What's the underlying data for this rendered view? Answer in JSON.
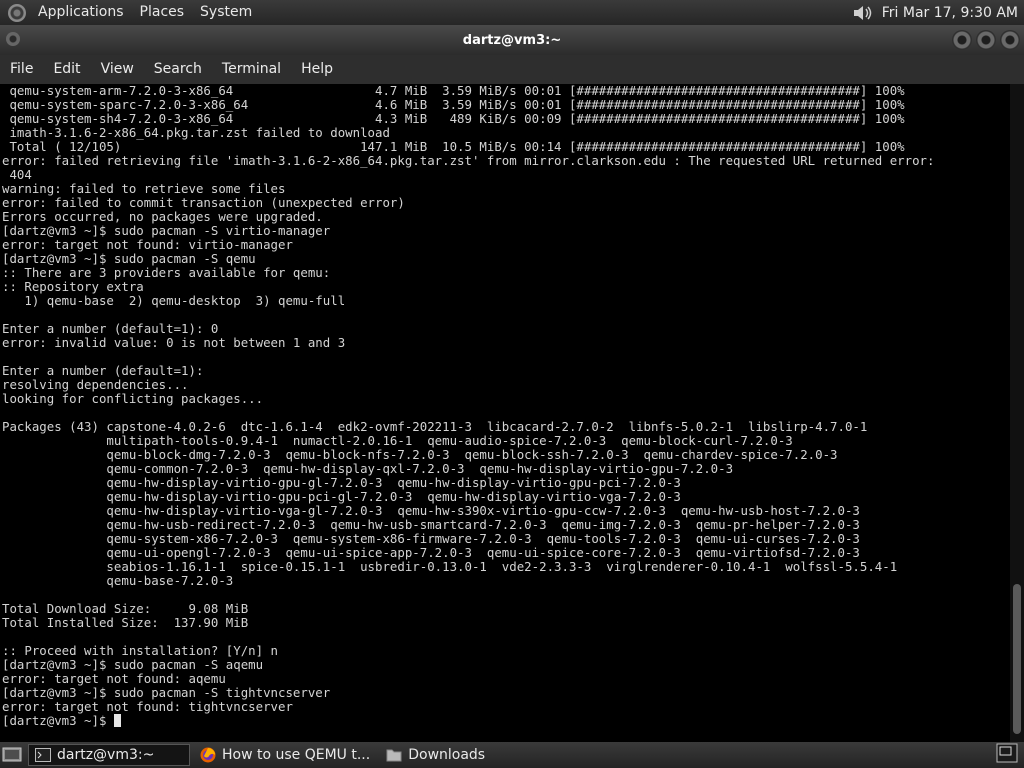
{
  "topbar": {
    "menus": [
      "Applications",
      "Places",
      "System"
    ],
    "datetime": "Fri Mar 17,  9:30 AM"
  },
  "window": {
    "title": "dartz@vm3:~"
  },
  "menubar": {
    "items": [
      "File",
      "Edit",
      "View",
      "Search",
      "Terminal",
      "Help"
    ]
  },
  "terminal": {
    "lines": [
      " qemu-system-arm-7.2.0-3-x86_64                   4.7 MiB  3.59 MiB/s 00:01 [######################################] 100%",
      " qemu-system-sparc-7.2.0-3-x86_64                 4.6 MiB  3.59 MiB/s 00:01 [######################################] 100%",
      " qemu-system-sh4-7.2.0-3-x86_64                   4.3 MiB   489 KiB/s 00:09 [######################################] 100%",
      " imath-3.1.6-2-x86_64.pkg.tar.zst failed to download",
      " Total ( 12/105)                                147.1 MiB  10.5 MiB/s 00:14 [######################################] 100%",
      "error: failed retrieving file 'imath-3.1.6-2-x86_64.pkg.tar.zst' from mirror.clarkson.edu : The requested URL returned error:",
      " 404",
      "warning: failed to retrieve some files",
      "error: failed to commit transaction (unexpected error)",
      "Errors occurred, no packages were upgraded.",
      "[dartz@vm3 ~]$ sudo pacman -S virtio-manager",
      "error: target not found: virtio-manager",
      "[dartz@vm3 ~]$ sudo pacman -S qemu",
      ":: There are 3 providers available for qemu:",
      ":: Repository extra",
      "   1) qemu-base  2) qemu-desktop  3) qemu-full",
      "",
      "Enter a number (default=1): 0",
      "error: invalid value: 0 is not between 1 and 3",
      "",
      "Enter a number (default=1):",
      "resolving dependencies...",
      "looking for conflicting packages...",
      "",
      "Packages (43) capstone-4.0.2-6  dtc-1.6.1-4  edk2-ovmf-202211-3  libcacard-2.7.0-2  libnfs-5.0.2-1  libslirp-4.7.0-1",
      "              multipath-tools-0.9.4-1  numactl-2.0.16-1  qemu-audio-spice-7.2.0-3  qemu-block-curl-7.2.0-3",
      "              qemu-block-dmg-7.2.0-3  qemu-block-nfs-7.2.0-3  qemu-block-ssh-7.2.0-3  qemu-chardev-spice-7.2.0-3",
      "              qemu-common-7.2.0-3  qemu-hw-display-qxl-7.2.0-3  qemu-hw-display-virtio-gpu-7.2.0-3",
      "              qemu-hw-display-virtio-gpu-gl-7.2.0-3  qemu-hw-display-virtio-gpu-pci-7.2.0-3",
      "              qemu-hw-display-virtio-gpu-pci-gl-7.2.0-3  qemu-hw-display-virtio-vga-7.2.0-3",
      "              qemu-hw-display-virtio-vga-gl-7.2.0-3  qemu-hw-s390x-virtio-gpu-ccw-7.2.0-3  qemu-hw-usb-host-7.2.0-3",
      "              qemu-hw-usb-redirect-7.2.0-3  qemu-hw-usb-smartcard-7.2.0-3  qemu-img-7.2.0-3  qemu-pr-helper-7.2.0-3",
      "              qemu-system-x86-7.2.0-3  qemu-system-x86-firmware-7.2.0-3  qemu-tools-7.2.0-3  qemu-ui-curses-7.2.0-3",
      "              qemu-ui-opengl-7.2.0-3  qemu-ui-spice-app-7.2.0-3  qemu-ui-spice-core-7.2.0-3  qemu-virtiofsd-7.2.0-3",
      "              seabios-1.16.1-1  spice-0.15.1-1  usbredir-0.13.0-1  vde2-2.3.3-3  virglrenderer-0.10.4-1  wolfssl-5.5.4-1",
      "              qemu-base-7.2.0-3",
      "",
      "Total Download Size:     9.08 MiB",
      "Total Installed Size:  137.90 MiB",
      "",
      ":: Proceed with installation? [Y/n] n",
      "[dartz@vm3 ~]$ sudo pacman -S aqemu",
      "error: target not found: aqemu",
      "[dartz@vm3 ~]$ sudo pacman -S tightvncserver",
      "error: target not found: tightvncserver"
    ],
    "prompt": "[dartz@vm3 ~]$ "
  },
  "taskbar": {
    "tasks": [
      {
        "label": "dartz@vm3:~",
        "icon": "terminal-icon"
      },
      {
        "label": "How to use QEMU t...",
        "icon": "firefox-icon"
      },
      {
        "label": "Downloads",
        "icon": "folder-icon"
      }
    ]
  }
}
